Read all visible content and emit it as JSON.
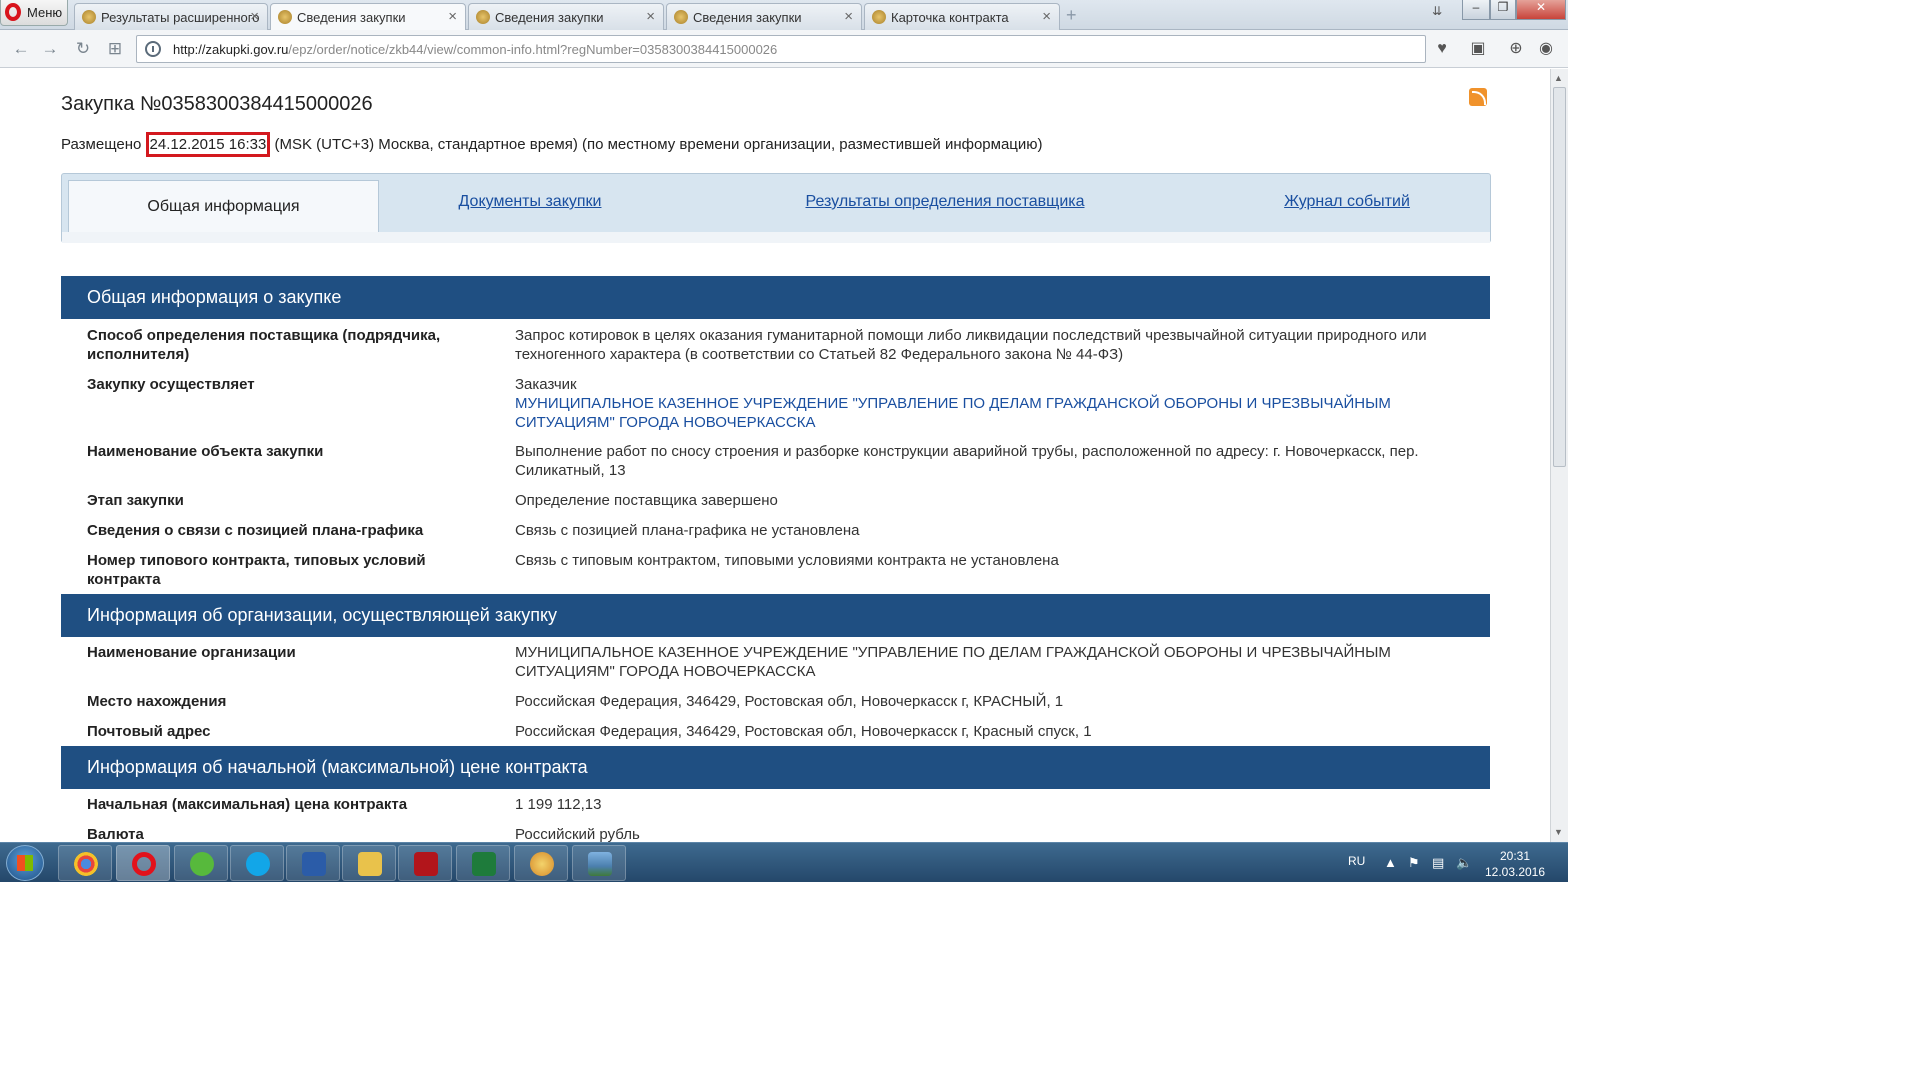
{
  "browser": {
    "menu_label": "Меню",
    "tabs": [
      {
        "label": "Результаты расширенного"
      },
      {
        "label": "Сведения закупки"
      },
      {
        "label": "Сведения закупки"
      },
      {
        "label": "Сведения закупки"
      },
      {
        "label": "Карточка контракта"
      }
    ],
    "active_tab_index": 1,
    "url_host": "http://zakupki.gov.ru",
    "url_path": "/epz/order/notice/zkb44/view/common-info.html?regNumber=0358300384415000026"
  },
  "page": {
    "title": "Закупка №0358300384415000026",
    "posted_label": "Размещено",
    "posted_datetime": "24.12.2015 16:33",
    "posted_tz": "(MSK (UTC+3) Москва, стандартное время) (по местному времени организации, разместившей информацию)",
    "tabs": [
      {
        "label": "Общая информация"
      },
      {
        "label": "Документы закупки"
      },
      {
        "label": "Результаты определения поставщика"
      },
      {
        "label": "Журнал событий"
      }
    ],
    "sections": {
      "general": {
        "title": "Общая информация о закупке",
        "rows": [
          {
            "key": "Способ определения поставщика (подрядчика, исполнителя)",
            "value": "Запрос котировок в целях оказания гуманитарной помощи либо ликвидации последствий чрезвычайной ситуации природного или техногенного характера (в соответствии со Статьей 82 Федерального закона № 44-ФЗ)"
          },
          {
            "key": "Закупку осуществляет",
            "value": "Заказчик",
            "link": "МУНИЦИПАЛЬНОЕ КАЗЕННОЕ УЧРЕЖДЕНИЕ \"УПРАВЛЕНИЕ ПО ДЕЛАМ ГРАЖДАНСКОЙ ОБОРОНЫ И ЧРЕЗВЫЧАЙНЫМ СИТУАЦИЯМ\" ГОРОДА НОВОЧЕРКАССКА"
          },
          {
            "key": "Наименование объекта закупки",
            "value": "Выполнение работ по сносу строения и разборке конструкции аварийной трубы, расположенной по адресу: г. Новочеркасск, пер. Силикатный, 13"
          },
          {
            "key": "Этап закупки",
            "value": "Определение поставщика завершено"
          },
          {
            "key": "Сведения о связи с позицией плана-графика",
            "value": "Связь с позицией плана-графика не установлена"
          },
          {
            "key": "Номер типового контракта, типовых условий контракта",
            "value": "Связь с типовым контрактом, типовыми условиями контракта не установлена"
          }
        ]
      },
      "org": {
        "title": "Информация об организации, осуществляющей закупку",
        "rows": [
          {
            "key": "Наименование организации",
            "value": "МУНИЦИПАЛЬНОЕ КАЗЕННОЕ УЧРЕЖДЕНИЕ \"УПРАВЛЕНИЕ ПО ДЕЛАМ ГРАЖДАНСКОЙ ОБОРОНЫ И ЧРЕЗВЫЧАЙНЫМ СИТУАЦИЯМ\" ГОРОДА НОВОЧЕРКАССКА"
          },
          {
            "key": "Место нахождения",
            "value": "Российская Федерация, 346429, Ростовская обл, Новочеркасск г, КРАСНЫЙ, 1"
          },
          {
            "key": "Почтовый адрес",
            "value": "Российская Федерация, 346429, Ростовская обл, Новочеркасск г, Красный спуск, 1"
          }
        ]
      },
      "price": {
        "title": "Информация об начальной (максимальной) цене контракта",
        "rows": [
          {
            "key": "Начальная (максимальная) цена контракта",
            "value": "1 199 112,13"
          },
          {
            "key": "Валюта",
            "value": "Российский рубль"
          }
        ]
      }
    }
  },
  "taskbar": {
    "lang": "RU",
    "time": "20:31",
    "date": "12.03.2016"
  },
  "colors": {
    "section_header": "#1f4f82",
    "link": "#1a4fa0",
    "highlight_box": "#d3181e"
  }
}
